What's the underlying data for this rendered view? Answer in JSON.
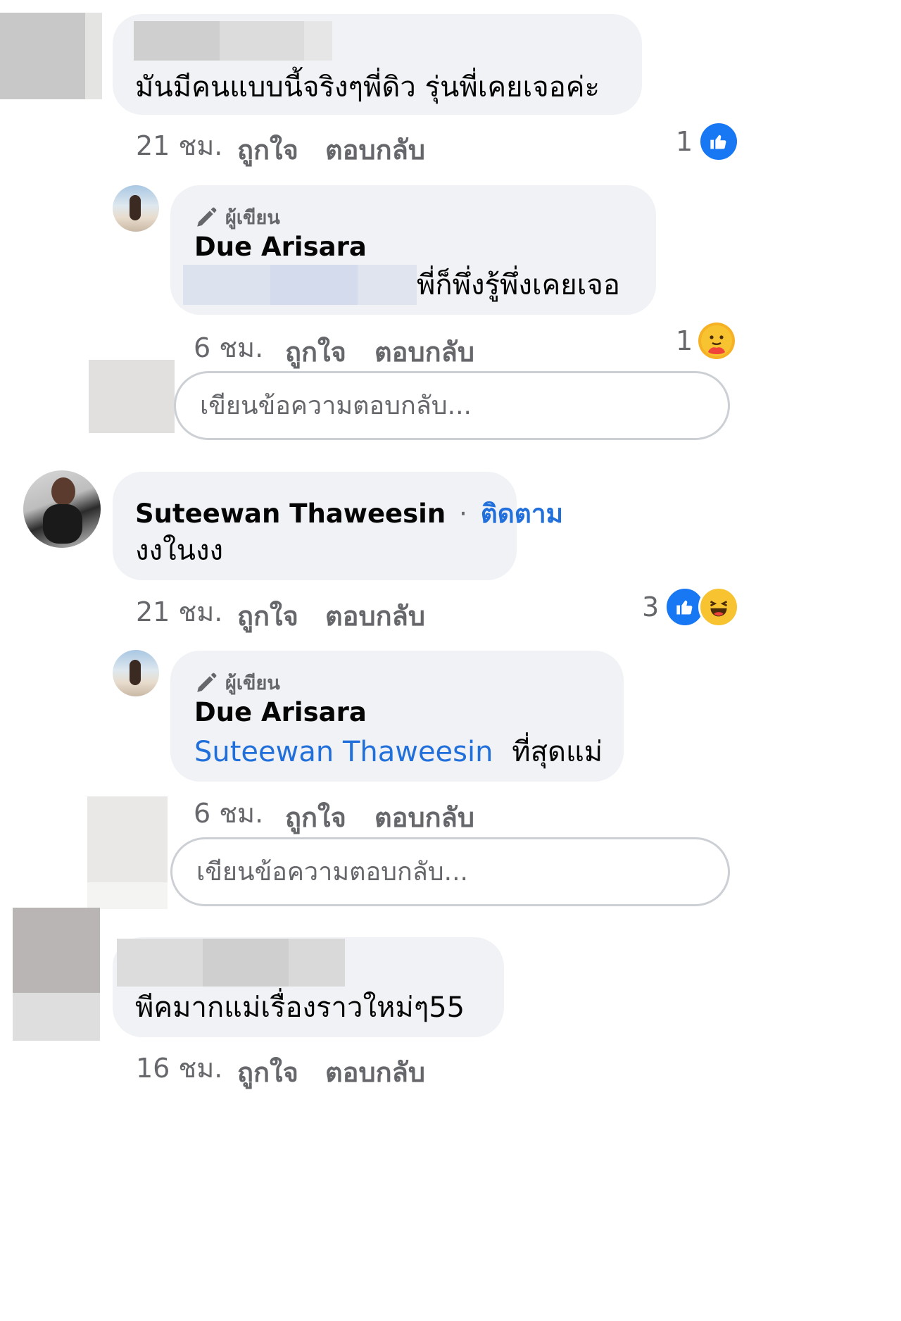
{
  "comments": [
    {
      "text": "มันมีคนแบบนี้จริงๆพี่ดิว รุ่นพี่เคยเจอค่ะ",
      "time": "21 ชม.",
      "like_label": "ถูกใจ",
      "reply_label": "ตอบกลับ",
      "reaction_count": "1",
      "reaction_icons": [
        "like-icon"
      ],
      "reply": {
        "author_badge": "ผู้เขียน",
        "author": "Due Arisara",
        "text": "พี่ก็พึ่งรู้พึ่งเคยเจอ",
        "time": "6 ชม.",
        "like_label": "ถูกใจ",
        "reply_label": "ตอบกลับ",
        "reaction_count": "1",
        "reaction_icons": [
          "care-icon"
        ]
      },
      "reply_input_placeholder": "เขียนข้อความตอบกลับ..."
    },
    {
      "author": "Suteewan Thaweesin",
      "separator": "·",
      "follow_label": "ติดตาม",
      "text": "งงในงง",
      "time": "21 ชม.",
      "like_label": "ถูกใจ",
      "reply_label": "ตอบกลับ",
      "reaction_count": "3",
      "reaction_icons": [
        "like-icon",
        "haha-icon"
      ],
      "reply": {
        "author_badge": "ผู้เขียน",
        "author": "Due Arisara",
        "mention": "Suteewan Thaweesin",
        "text": "ที่สุดแม่",
        "time": "6 ชม.",
        "like_label": "ถูกใจ",
        "reply_label": "ตอบกลับ"
      },
      "reply_input_placeholder": "เขียนข้อความตอบกลับ..."
    },
    {
      "text": "พีคมากแม่เรื่องราวใหม่ๆ55",
      "time": "16 ชม.",
      "like_label": "ถูกใจ",
      "reply_label": "ตอบกลับ"
    }
  ],
  "colors": {
    "bubble": "#f0f2f5",
    "secondary_text": "#65676b",
    "link": "#216fdb",
    "like_blue": "#1877f2",
    "haha_yellow": "#f7b125"
  }
}
